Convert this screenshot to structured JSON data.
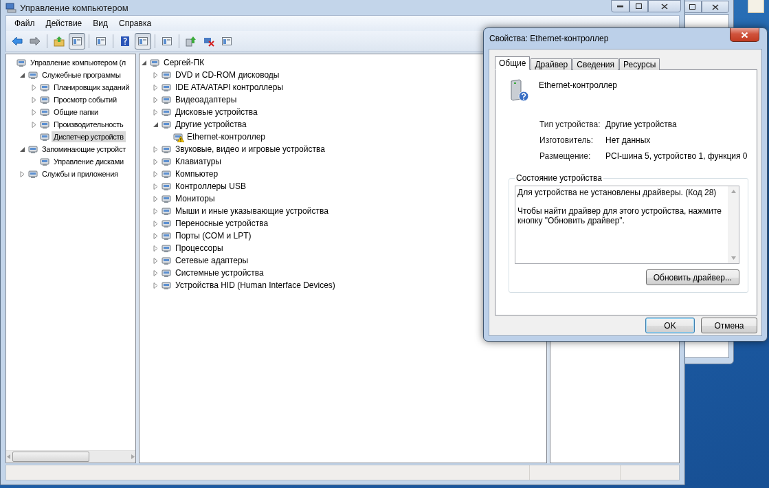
{
  "main_window": {
    "title": "Управление компьютером",
    "menu": [
      "Файл",
      "Действие",
      "Вид",
      "Справка"
    ],
    "toolbar": [
      {
        "kind": "button",
        "pressed": false
      },
      {
        "kind": "button",
        "pressed": false
      },
      {
        "kind": "separator"
      },
      {
        "kind": "button",
        "pressed": false
      },
      {
        "kind": "button",
        "pressed": true
      },
      {
        "kind": "separator"
      },
      {
        "kind": "button",
        "pressed": false
      },
      {
        "kind": "separator"
      },
      {
        "kind": "button",
        "pressed": false
      },
      {
        "kind": "button",
        "pressed": true
      },
      {
        "kind": "separator"
      },
      {
        "kind": "button",
        "pressed": false
      },
      {
        "kind": "separator"
      },
      {
        "kind": "button",
        "pressed": false
      },
      {
        "kind": "button",
        "pressed": false
      },
      {
        "kind": "button",
        "pressed": false
      }
    ],
    "console_tree": [
      {
        "label": "Управление компьютером (л",
        "selected": false,
        "children": [
          {
            "label": "Служебные программы",
            "expanded": true,
            "selected": false,
            "children": [
              {
                "label": "Планировщик заданий",
                "expanded": false,
                "selected": false
              },
              {
                "label": "Просмотр событий",
                "expanded": false,
                "selected": false
              },
              {
                "label": "Общие папки",
                "expanded": false,
                "selected": false
              },
              {
                "label": "Производительность",
                "expanded": false,
                "selected": false
              },
              {
                "label": "Диспетчер устройств",
                "selected": true
              }
            ]
          },
          {
            "label": "Запоминающие устройст",
            "expanded": true,
            "selected": false,
            "children": [
              {
                "label": "Управление дисками",
                "selected": false
              }
            ]
          },
          {
            "label": "Службы и приложения",
            "expanded": false,
            "selected": false
          }
        ]
      }
    ],
    "device_tree": [
      {
        "label": "Сергей-ПК",
        "expanded": true,
        "selected": false,
        "children": [
          {
            "label": "DVD и CD-ROM дисководы",
            "expanded": false,
            "selected": false
          },
          {
            "label": "IDE ATA/ATAPI контроллеры",
            "expanded": false,
            "selected": false
          },
          {
            "label": "Видеоадаптеры",
            "expanded": false,
            "selected": false
          },
          {
            "label": "Дисковые устройства",
            "expanded": false,
            "selected": false
          },
          {
            "label": "Другие устройства",
            "expanded": true,
            "selected": false,
            "children": [
              {
                "label": "Ethernet-контроллер",
                "selected": false,
                "warning": true
              }
            ]
          },
          {
            "label": "Звуковые, видео и игровые устройства",
            "expanded": false,
            "selected": false
          },
          {
            "label": "Клавиатуры",
            "expanded": false,
            "selected": false
          },
          {
            "label": "Компьютер",
            "expanded": false,
            "selected": false
          },
          {
            "label": "Контроллеры USB",
            "expanded": false,
            "selected": false
          },
          {
            "label": "Мониторы",
            "expanded": false,
            "selected": false
          },
          {
            "label": "Мыши и иные указывающие устройства",
            "expanded": false,
            "selected": false
          },
          {
            "label": "Переносные устройства",
            "expanded": false,
            "selected": false
          },
          {
            "label": "Порты (COM и LPT)",
            "expanded": false,
            "selected": false
          },
          {
            "label": "Процессоры",
            "expanded": false,
            "selected": false
          },
          {
            "label": "Сетевые адаптеры",
            "expanded": false,
            "selected": false
          },
          {
            "label": "Системные устройства",
            "expanded": false,
            "selected": false
          },
          {
            "label": "Устройства HID (Human Interface Devices)",
            "expanded": false,
            "selected": false
          }
        ]
      }
    ]
  },
  "dialog": {
    "title": "Свойства: Ethernet-контроллер",
    "tabs": [
      {
        "label": "Общие",
        "selected": true
      },
      {
        "label": "Драйвер",
        "selected": false
      },
      {
        "label": "Сведения",
        "selected": false
      },
      {
        "label": "Ресурсы",
        "selected": false
      }
    ],
    "device_name": "Ethernet-контроллер",
    "properties": [
      {
        "label": "Тип устройства:",
        "value": "Другие устройства"
      },
      {
        "label": "Изготовитель:",
        "value": "Нет данных"
      },
      {
        "label": "Размещение:",
        "value": "PCI-шина 5, устройство 1, функция 0"
      }
    ],
    "status_group": {
      "title": "Состояние устройства",
      "messages": [
        "Для устройства не установлены драйверы. (Код 28)",
        "Чтобы найти драйвер для этого устройства, нажмите кнопку \"Обновить драйвер\"."
      ],
      "button": "Обновить драйвер..."
    },
    "buttons": [
      {
        "label": "OK",
        "default": true
      },
      {
        "label": "Отмена",
        "default": false
      }
    ]
  }
}
